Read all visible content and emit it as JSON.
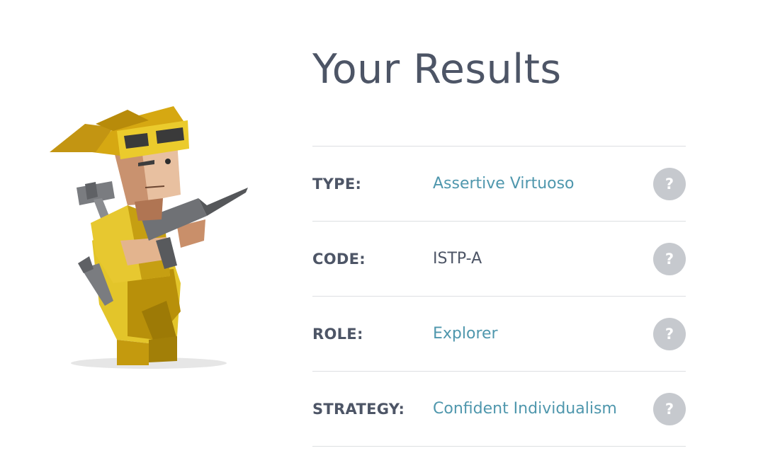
{
  "page": {
    "title": "Your Results"
  },
  "results": [
    {
      "label": "TYPE:",
      "value": "Assertive Virtuoso",
      "is_link": true,
      "help": "?"
    },
    {
      "label": "CODE:",
      "value": "ISTP-A",
      "is_link": false,
      "help": "?"
    },
    {
      "label": "ROLE:",
      "value": "Explorer",
      "is_link": true,
      "help": "?"
    },
    {
      "label": "STRATEGY:",
      "value": "Confident Individualism",
      "is_link": true,
      "help": "?"
    }
  ],
  "colors": {
    "title": "#4d5566",
    "link": "#4f97ad",
    "help_badge": "#c6c9ce",
    "divider": "#dddfe2"
  },
  "illustration": {
    "icon": "virtuoso-character-icon"
  }
}
